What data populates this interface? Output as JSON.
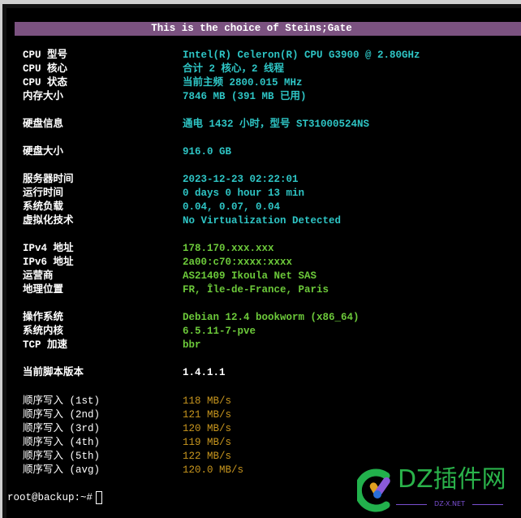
{
  "banner": "This is the choice of Steins;Gate",
  "rows": [
    {
      "label": "CPU 型号",
      "value": "Intel(R) Celeron(R) CPU G3900 @ 2.80GHz"
    },
    {
      "label": "CPU 核心",
      "value": "合计 2 核心，2 线程"
    },
    {
      "label": "CPU 状态",
      "value": "当前主频 2800.015 MHz"
    },
    {
      "label": "内存大小",
      "value": "7846 MB (391 MB 已用)"
    },
    {
      "label": "硬盘信息",
      "value": "通电 1432 小时，型号 ST31000524NS"
    },
    {
      "label": "硬盘大小",
      "value": "916.0 GB"
    },
    {
      "label": "服务器时间",
      "value": "2023-12-23 02:22:01"
    },
    {
      "label": "运行时间",
      "value": "0 days 0 hour 13 min"
    },
    {
      "label": "系统负载",
      "value": "0.04, 0.07, 0.04"
    },
    {
      "label": "虚拟化技术",
      "value": "No Virtualization Detected"
    },
    {
      "label": "IPv4 地址",
      "value": "178.170.xxx.xxx"
    },
    {
      "label": "IPv6 地址",
      "value": "2a00:c70:xxxx:xxxx"
    },
    {
      "label": "运营商",
      "value": "AS21409 Ikoula Net SAS"
    },
    {
      "label": "地理位置",
      "value": "FR, Île-de-France, Paris"
    },
    {
      "label": "操作系统",
      "value": "Debian 12.4 bookworm (x86_64)"
    },
    {
      "label": "系统内核",
      "value": "6.5.11-7-pve"
    },
    {
      "label": "TCP 加速",
      "value": "bbr"
    },
    {
      "label": "当前脚本版本",
      "value": "1.4.1.1"
    },
    {
      "label": "顺序写入 (1st)",
      "value": "118 MB/s"
    },
    {
      "label": "顺序写入 (2nd)",
      "value": "121 MB/s"
    },
    {
      "label": "顺序写入 (3rd)",
      "value": "120 MB/s"
    },
    {
      "label": "顺序写入 (4th)",
      "value": "119 MB/s"
    },
    {
      "label": "顺序写入 (5th)",
      "value": "122 MB/s"
    },
    {
      "label": "顺序写入 (avg)",
      "value": "120.0 MB/s"
    }
  ],
  "prompt": "root@backup:~#",
  "watermark": {
    "title": "DZ插件网",
    "subtitle": "DZ-X.NET"
  },
  "colors": {
    "banner": "#7b5280",
    "cyan": "#2ec5c5",
    "green": "#6cc93a",
    "orange": "#c8961e"
  }
}
